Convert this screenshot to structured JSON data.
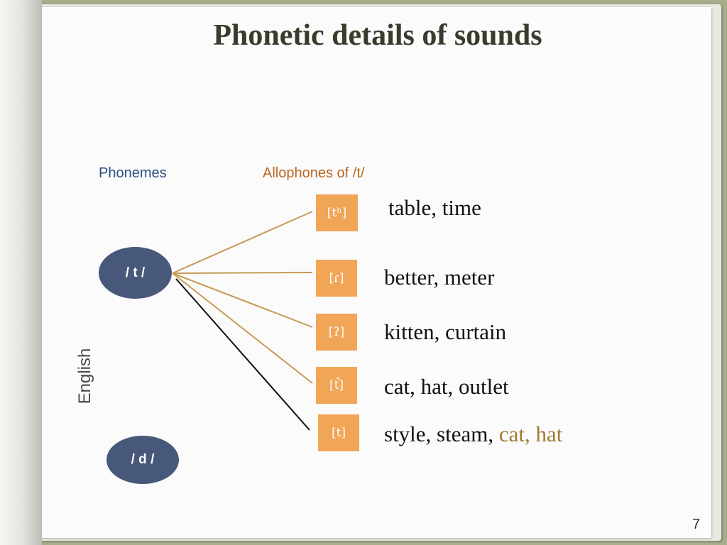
{
  "slide": {
    "title": "Phonetic details of sounds",
    "page_number": "7"
  },
  "labels": {
    "phonemes": "Phonemes",
    "allophones": "Allophones of /t/",
    "language": "English"
  },
  "phonemes": {
    "t": "/ t /",
    "d": "/ d /"
  },
  "allophones": [
    {
      "symbol": "[tʰ]",
      "examples": "table, time"
    },
    {
      "symbol": "[ɾ]",
      "examples": "better, meter"
    },
    {
      "symbol": "[ʔ]",
      "examples": "kitten, curtain"
    },
    {
      "symbol": "[t̚]",
      "examples": "cat, hat, outlet"
    },
    {
      "symbol": "[t]",
      "examples": "style, steam, ",
      "highlighted_examples": "cat, hat"
    }
  ],
  "colors": {
    "phoneme_oval": "#48587a",
    "allophone_box": "#f1a556",
    "connector_line": "#c69a55",
    "special_connector_line": "#111111",
    "phonemes_label": "#2c4f7c",
    "allophones_label": "#b8651e",
    "highlighted_examples": "#a07a2e"
  }
}
